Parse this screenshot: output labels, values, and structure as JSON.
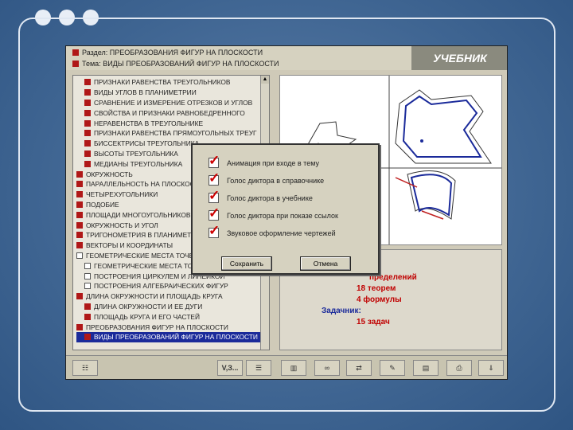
{
  "header": {
    "section_label": "Раздел: ПРЕОБРАЗОВАНИЯ ФИГУР НА ПЛОСКОСТИ",
    "topic_label": "Тема: ВИДЫ ПРЕОБРАЗОВАНИЙ ФИГУР НА ПЛОСКОСТИ",
    "brand": "УЧЕБНИК"
  },
  "tree": [
    {
      "label": "ПРИЗНАКИ РАВЕНСТВА ТРЕУГОЛЬНИКОВ",
      "box": "red",
      "indent": 1
    },
    {
      "label": "ВИДЫ УГЛОВ В ПЛАНИМЕТРИИ",
      "box": "red",
      "indent": 1
    },
    {
      "label": "СРАВНЕНИЕ И ИЗМЕРЕНИЕ ОТРЕЗКОВ И УГЛОВ",
      "box": "red",
      "indent": 1
    },
    {
      "label": "СВОЙСТВА И ПРИЗНАКИ РАВНОБЕДРЕННОГО",
      "box": "red",
      "indent": 1
    },
    {
      "label": "НЕРАВЕНСТВА В ТРЕУГОЛЬНИКЕ",
      "box": "red",
      "indent": 1
    },
    {
      "label": "ПРИЗНАКИ РАВЕНСТВА ПРЯМОУГОЛЬНЫХ ТРЕУГ",
      "box": "red",
      "indent": 1
    },
    {
      "label": "БИССЕКТРИСЫ ТРЕУГОЛЬНИКА",
      "box": "red",
      "indent": 1
    },
    {
      "label": "ВЫСОТЫ ТРЕУГОЛЬНИКА",
      "box": "red",
      "indent": 1
    },
    {
      "label": "МЕДИАНЫ ТРЕУГОЛЬНИКА",
      "box": "red",
      "indent": 1
    },
    {
      "label": "ОКРУЖНОСТЬ",
      "box": "red",
      "indent": 0
    },
    {
      "label": "ПАРАЛЛЕЛЬНОСТЬ НА ПЛОСКОСТИ",
      "box": "red",
      "indent": 0
    },
    {
      "label": "ЧЕТЫРЕХУГОЛЬНИКИ",
      "box": "red",
      "indent": 0
    },
    {
      "label": "ПОДОБИЕ",
      "box": "red",
      "indent": 0
    },
    {
      "label": "ПЛОЩАДИ МНОГОУГОЛЬНИКОВ",
      "box": "red",
      "indent": 0
    },
    {
      "label": "ОКРУЖНОСТЬ И УГОЛ",
      "box": "red",
      "indent": 0
    },
    {
      "label": "ТРИГОНОМЕТРИЯ В ПЛАНИМЕТРИИ",
      "box": "red",
      "indent": 0
    },
    {
      "label": "ВЕКТОРЫ И КООРДИНАТЫ",
      "box": "red",
      "indent": 0
    },
    {
      "label": "ГЕОМЕТРИЧЕСКИЕ МЕСТА ТОЧЕК",
      "box": "empty",
      "indent": 0
    },
    {
      "label": "ГЕОМЕТРИЧЕСКИЕ МЕСТА ТОЧЕК",
      "box": "empty",
      "indent": 1
    },
    {
      "label": "ПОСТРОЕНИЯ ЦИРКУЛЕМ И ЛИНЕЙКОЙ",
      "box": "empty",
      "indent": 1
    },
    {
      "label": "ПОСТРОЕНИЯ АЛГЕБРАИЧЕСКИХ ФИГУР",
      "box": "empty",
      "indent": 1
    },
    {
      "label": "ДЛИНА ОКРУЖНОСТИ И ПЛОЩАДЬ КРУГА",
      "box": "red",
      "indent": 0
    },
    {
      "label": "ДЛИНА ОКРУЖНОСТИ И ЕЕ ДУГИ",
      "box": "red",
      "indent": 1
    },
    {
      "label": "ПЛОЩАДЬ КРУГА И ЕГО ЧАСТЕЙ",
      "box": "red",
      "indent": 1
    },
    {
      "label": "ПРЕОБРАЗОВАНИЯ ФИГУР НА ПЛОСКОСТИ",
      "box": "red",
      "indent": 0
    },
    {
      "label": "ВИДЫ ПРЕОБРАЗОВАНИЙ ФИГУР НА ПЛОСКОСТИ",
      "box": "red",
      "indent": 1,
      "selected": true
    }
  ],
  "info": {
    "line1": "пределений",
    "line2": "18 теорем",
    "line3": "4 формулы",
    "line4": "Задачник:",
    "line5": "15 задач"
  },
  "dialog": {
    "options": [
      {
        "label": "Анимация при входе в тему",
        "checked": true
      },
      {
        "label": "Голос диктора в справочнике",
        "checked": true
      },
      {
        "label": "Голос диктора в учебнике",
        "checked": true
      },
      {
        "label": "Голос диктора при показе ссылок",
        "checked": true
      },
      {
        "label": "Звуковое оформление чертежей",
        "checked": true
      }
    ],
    "save_label": "Сохранить",
    "cancel_label": "Отмена"
  },
  "toolbar": {
    "vz_label": "V,З..."
  },
  "colors": {
    "accent_red": "#b01818",
    "selection_blue": "#1b2b9a",
    "figure_blue": "#1a2a9a",
    "info_red": "#c00000",
    "info_blue": "#1a2a9a"
  }
}
